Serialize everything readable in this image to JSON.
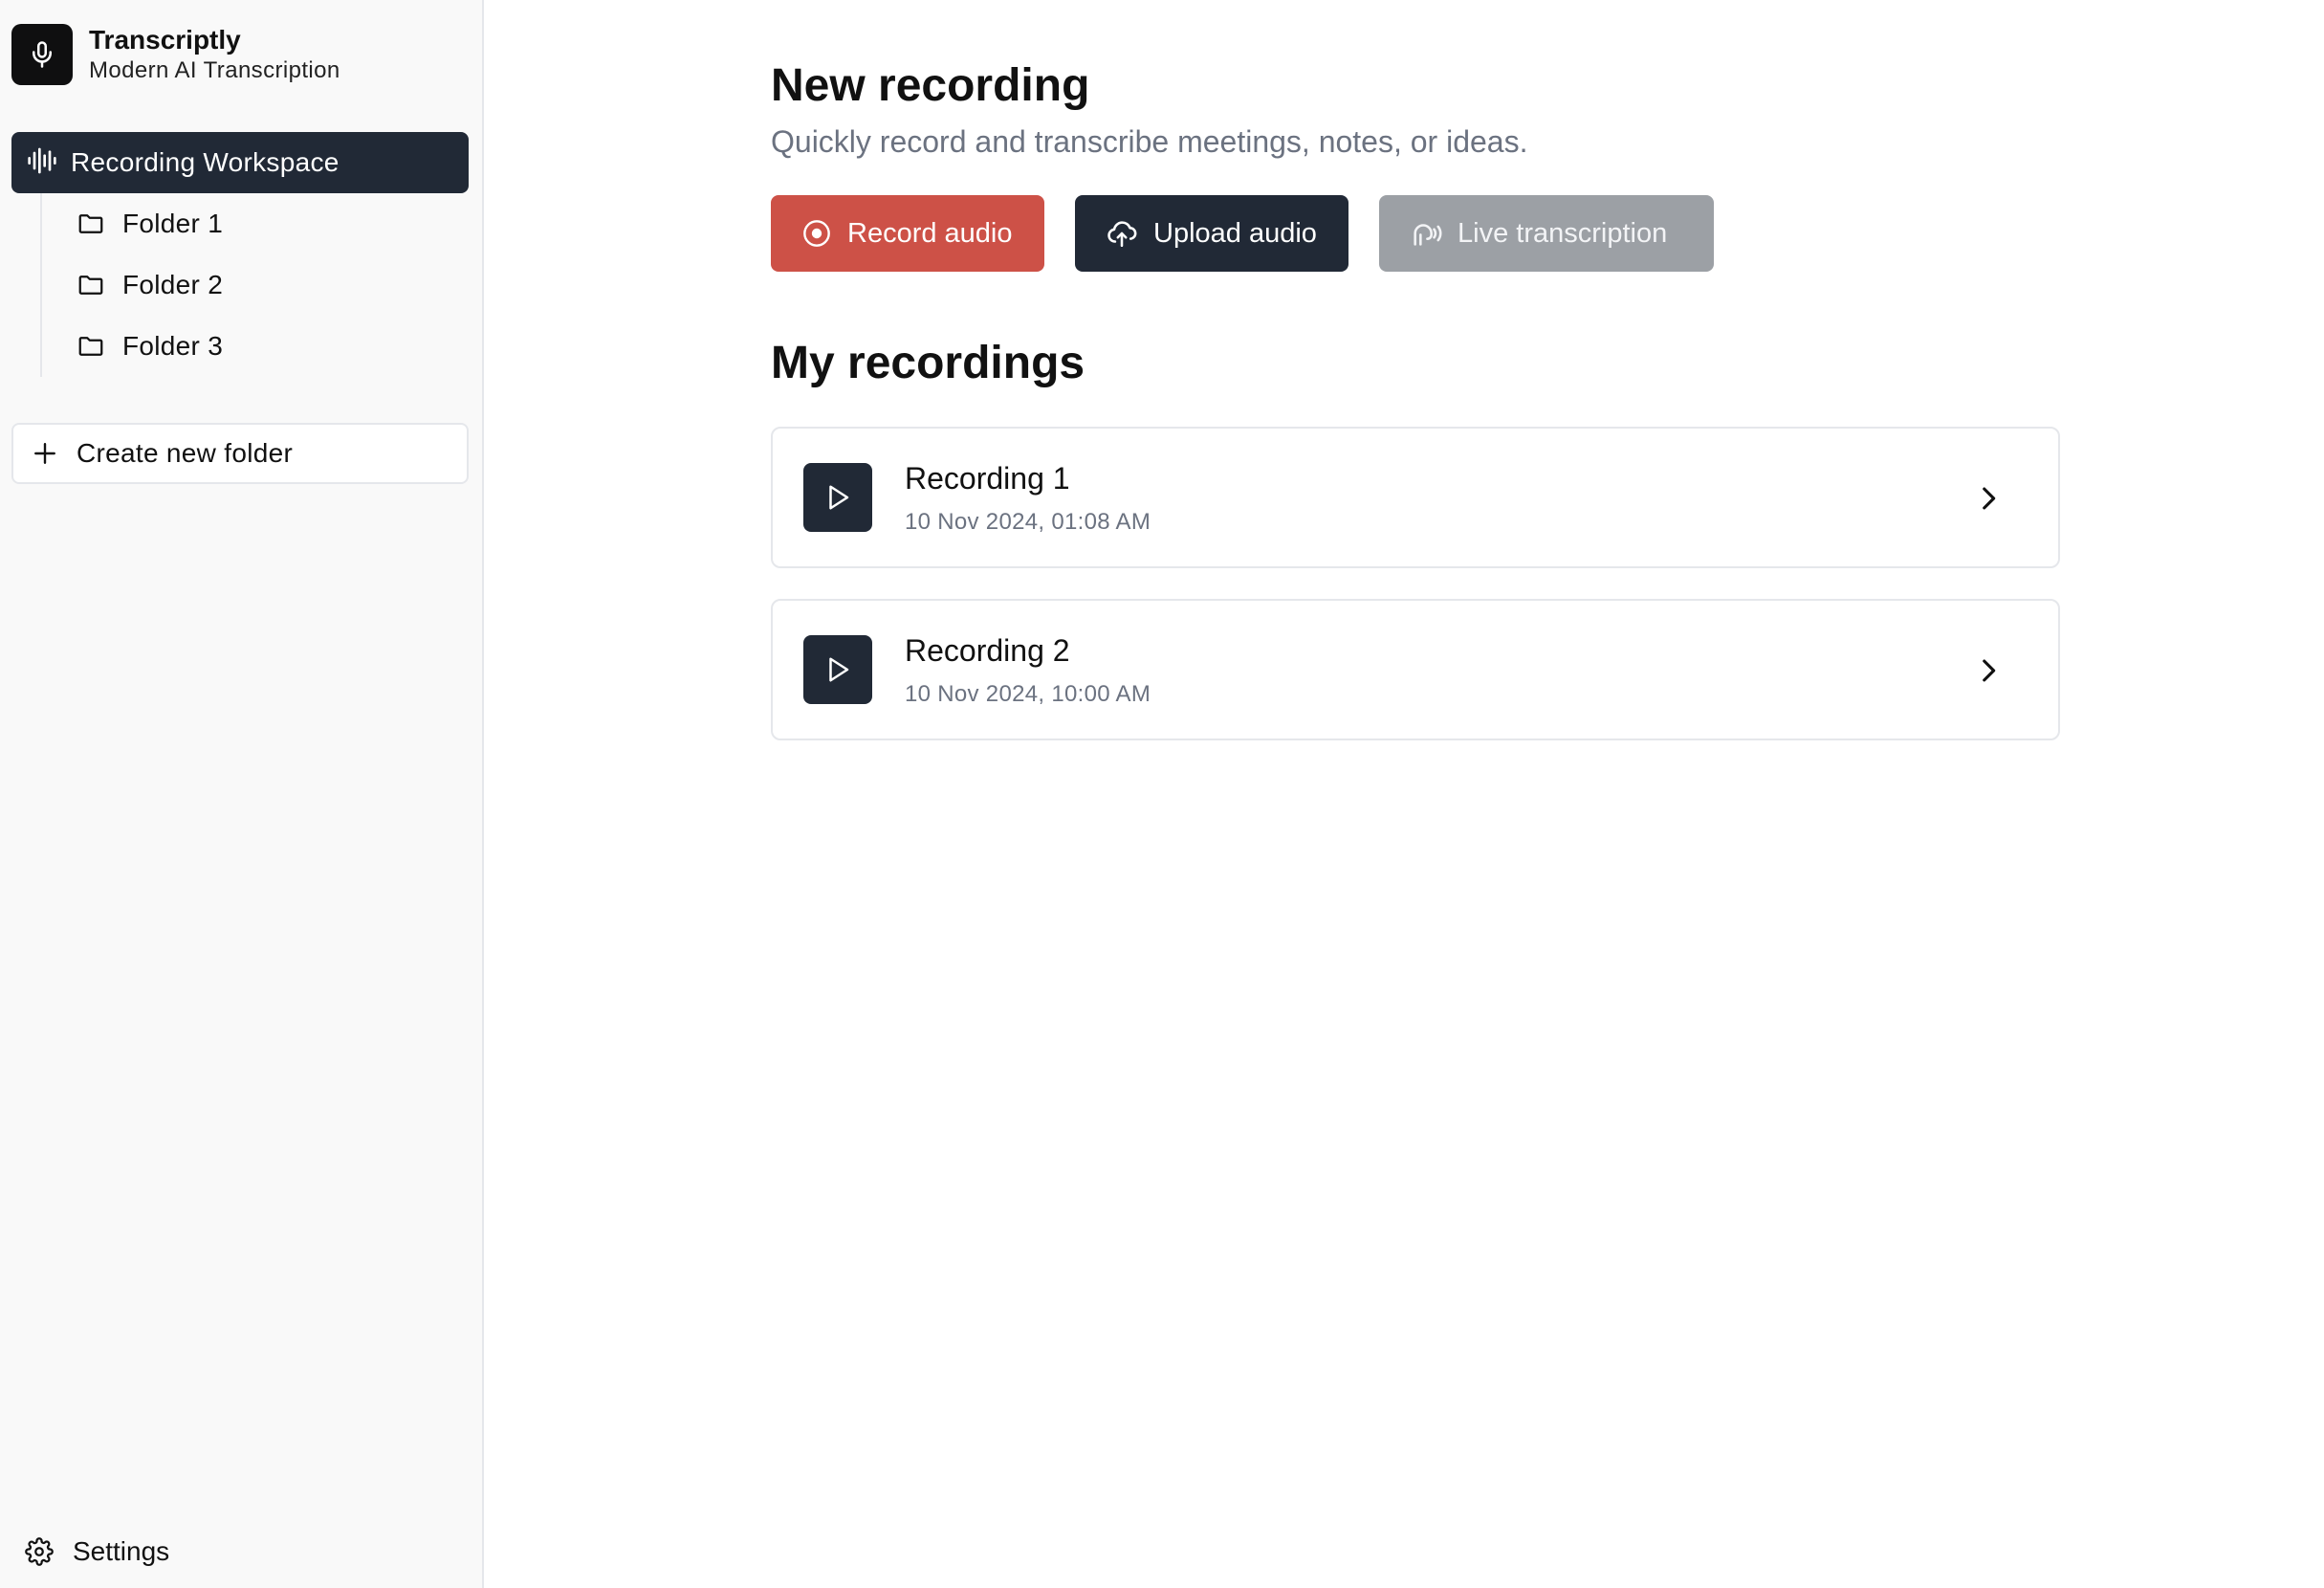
{
  "app": {
    "name": "Transcriptly",
    "tagline": "Modern AI Transcription"
  },
  "sidebar": {
    "workspace_label": "Recording Workspace",
    "folders": [
      {
        "label": "Folder 1"
      },
      {
        "label": "Folder 2"
      },
      {
        "label": "Folder 3"
      }
    ],
    "create_folder_label": "Create new folder",
    "settings_label": "Settings"
  },
  "main": {
    "title": "New recording",
    "subtitle": "Quickly record and transcribe meetings, notes, or ideas.",
    "buttons": {
      "record": "Record audio",
      "upload": "Upload audio",
      "live": "Live transcription"
    },
    "recordings_title": "My recordings",
    "recordings": [
      {
        "name": "Recording 1",
        "date": "10 Nov 2024, 01:08 AM"
      },
      {
        "name": "Recording 2",
        "date": "10 Nov 2024, 10:00 AM"
      }
    ]
  },
  "colors": {
    "accent_dark": "#212936",
    "record_red": "#cd5147",
    "disabled_gray": "#9ca0a5"
  },
  "icons": [
    "microphone-icon",
    "waveform-icon",
    "folder-icon",
    "plus-icon",
    "gear-icon",
    "record-icon",
    "cloud-upload-icon",
    "live-transcription-icon",
    "play-icon",
    "chevron-right-icon"
  ]
}
